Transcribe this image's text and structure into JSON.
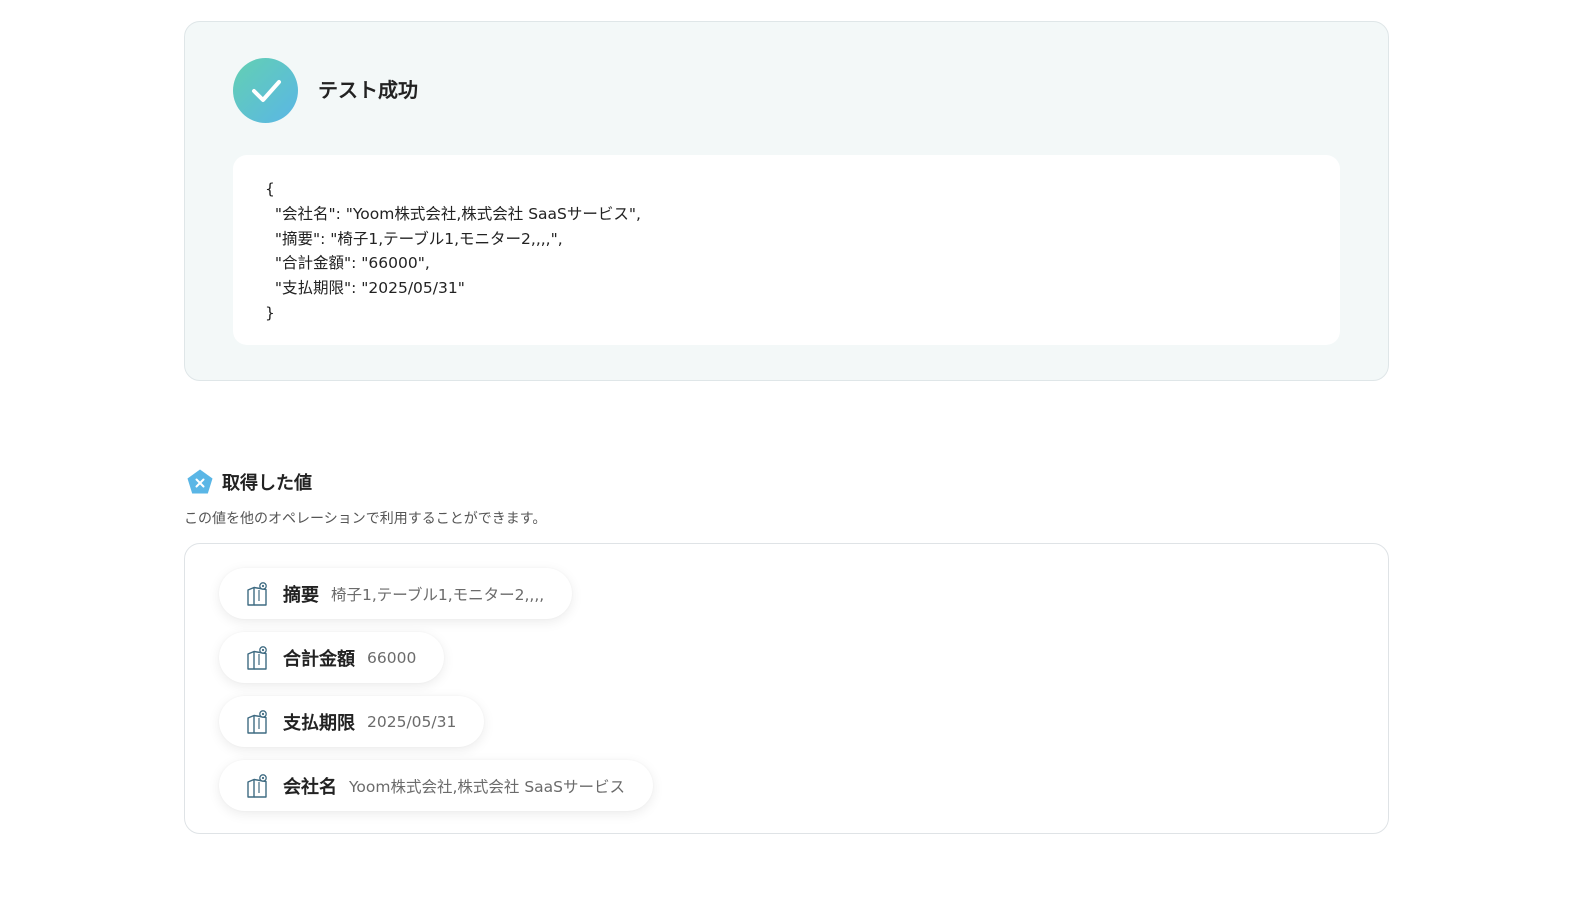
{
  "result": {
    "title": "テスト成功",
    "icon": "check-icon",
    "json_lines": [
      "{",
      "  \"会社名\": \"Yoom株式会社,株式会社 SaaSサービス\",",
      "  \"摘要\": \"椅子1,テーブル1,モニター2,,,,\",",
      "  \"合計金額\": \"66000\",",
      "  \"支払期限\": \"2025/05/31\"",
      "}"
    ]
  },
  "values_section": {
    "title": "取得した値",
    "icon": "variable-icon",
    "description": "この値を他のオペレーションで利用することができます。",
    "items": [
      {
        "label": "摘要",
        "value": "椅子1,テーブル1,モニター2,,,,",
        "icon": "copy-value-icon"
      },
      {
        "label": "合計金額",
        "value": "66000",
        "icon": "copy-value-icon"
      },
      {
        "label": "支払期限",
        "value": "2025/05/31",
        "icon": "copy-value-icon"
      },
      {
        "label": "会社名",
        "value": "Yoom株式会社,株式会社 SaaSサービス",
        "icon": "copy-value-icon"
      }
    ]
  },
  "colors": {
    "success_gradient_start": "#63d0b2",
    "success_gradient_end": "#5ab6e6",
    "card_background": "#f3f8f8",
    "section_icon": "#5ab6e6"
  }
}
